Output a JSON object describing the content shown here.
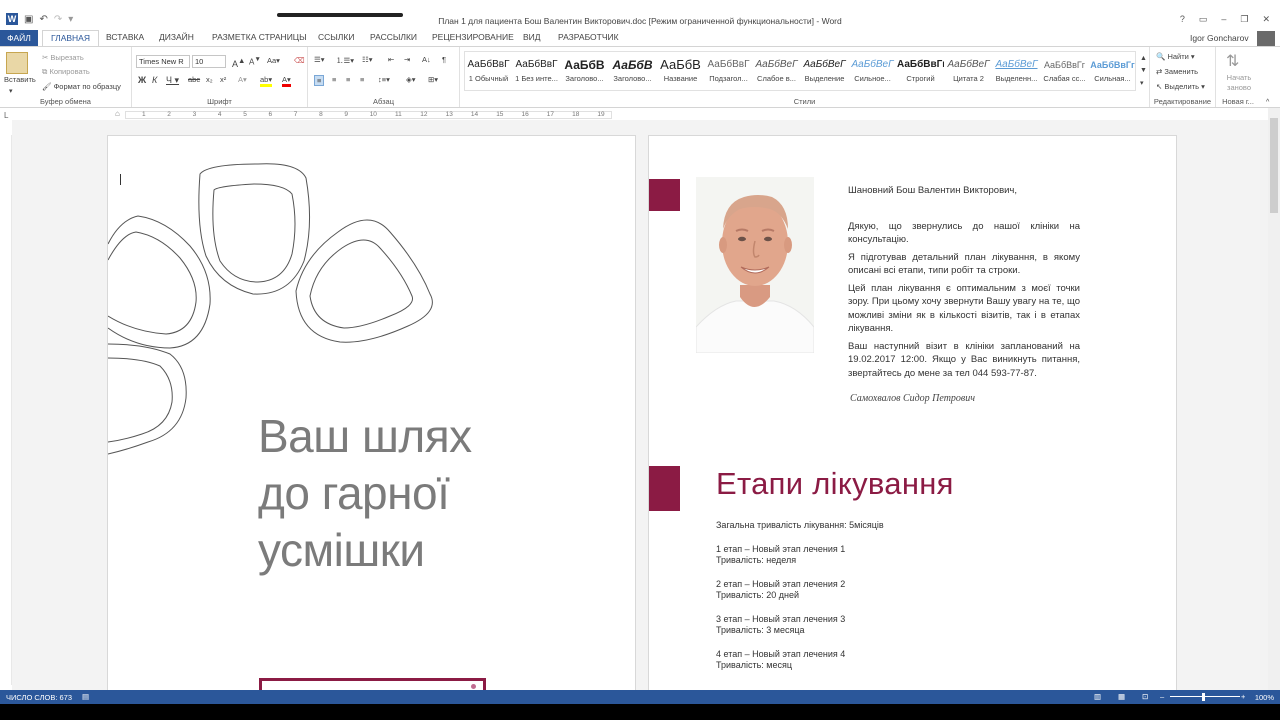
{
  "app": {
    "window_title": "План 1 для пациента Бош Валентин Викторович.doc [Режим ограниченной функциональности] - Word",
    "user_name": "Igor Goncharov"
  },
  "tabs": [
    "ФАЙЛ",
    "ГЛАВНАЯ",
    "ВСТАВКА",
    "ДИЗАЙН",
    "РАЗМЕТКА СТРАНИЦЫ",
    "ССЫЛКИ",
    "РАССЫЛКИ",
    "РЕЦЕНЗИРОВАНИЕ",
    "ВИД",
    "РАЗРАБОТЧИК"
  ],
  "ribbon": {
    "clipboard": {
      "paste": "Вставить",
      "cut": "Вырезать",
      "copy": "Копировать",
      "format_painter": "Формат по образцу",
      "label": "Буфер обмена"
    },
    "font": {
      "name": "Times New R",
      "size": "10",
      "label": "Шрифт"
    },
    "paragraph": {
      "label": "Абзац"
    },
    "styles": {
      "label": "Стили",
      "items": [
        {
          "preview": "АаБбВвГ",
          "name": "1 Обычный"
        },
        {
          "preview": "АаБбВвГ",
          "name": "1 Без инте..."
        },
        {
          "preview": "АаБбВ",
          "name": "Заголово..."
        },
        {
          "preview": "АаБбВ",
          "name": "Заголово..."
        },
        {
          "preview": "АаБбВ",
          "name": "Название"
        },
        {
          "preview": "АаБбВвГ",
          "name": "Подзагол..."
        },
        {
          "preview": "АаБбВеГ",
          "name": "Слабое в..."
        },
        {
          "preview": "АаБбВеГ",
          "name": "Выделение"
        },
        {
          "preview": "АаБбВеГ",
          "name": "Сильное..."
        },
        {
          "preview": "АаБбВвГг",
          "name": "Строгий"
        },
        {
          "preview": "АаБбВеГ",
          "name": "Цитата 2"
        },
        {
          "preview": "АаБбВеГ",
          "name": "Выделенн..."
        },
        {
          "preview": "АаБбВвГг",
          "name": "Слабая сс..."
        },
        {
          "preview": "АаБбВвГг",
          "name": "Сильная..."
        }
      ]
    },
    "editing": {
      "find": "Найти",
      "replace": "Заменить",
      "select": "Выделить",
      "label": "Редактирование"
    },
    "new_group": {
      "btn": "Начать заново",
      "label": "Новая г..."
    }
  },
  "ruler": {
    "ticks": [
      "1",
      "2",
      "3",
      "4",
      "5",
      "6",
      "7",
      "8",
      "9",
      "10",
      "11",
      "12",
      "13",
      "14",
      "15",
      "16",
      "17",
      "18",
      "19"
    ]
  },
  "page1": {
    "headline": [
      "Ваш шлях",
      "до гарної",
      "усмішки"
    ]
  },
  "page2": {
    "letter": {
      "greeting": "Шановний Бош Валентин Викторович,",
      "paragraphs": [
        "Дякую, що звернулись до нашої клініки на консультацію.",
        "Я підготував детальний план лікування, в якому описані всі етапи, типи робіт та строки.",
        "Цей план лікування є оптимальним з моєї точки зору. При цьому хочу звернути Вашу увагу на те, що можливі зміни як в кількості візитів, так і в етапах лікування.",
        "Ваш наступний візит в клініки запланований на 19.02.2017 12:00. Якщо у Вас виникнуть питання, звертайтесь до мене за тел 044 593-77-87."
      ],
      "signature": "Самохвалов Сидор Петрович"
    },
    "section_title": "Етапи лікування",
    "total_duration": "Загальна тривалість лікування: 5місяців",
    "stages": [
      {
        "title": "1 етап – Новый этап лечения 1",
        "duration": "Тривалість: неделя"
      },
      {
        "title": "2 етап – Новый этап лечения 2",
        "duration": "Тривалість: 20 дней"
      },
      {
        "title": "3 етап – Новый этап лечения 3",
        "duration": "Тривалість: 3 месяца"
      },
      {
        "title": "4 етап – Новый этап лечения 4",
        "duration": "Тривалість: месяц"
      }
    ]
  },
  "status": {
    "words": "ЧИСЛО СЛОВ: 673",
    "zoom": "100%"
  },
  "colors": {
    "accent": "#8b1b44",
    "word_blue": "#2b579a"
  }
}
